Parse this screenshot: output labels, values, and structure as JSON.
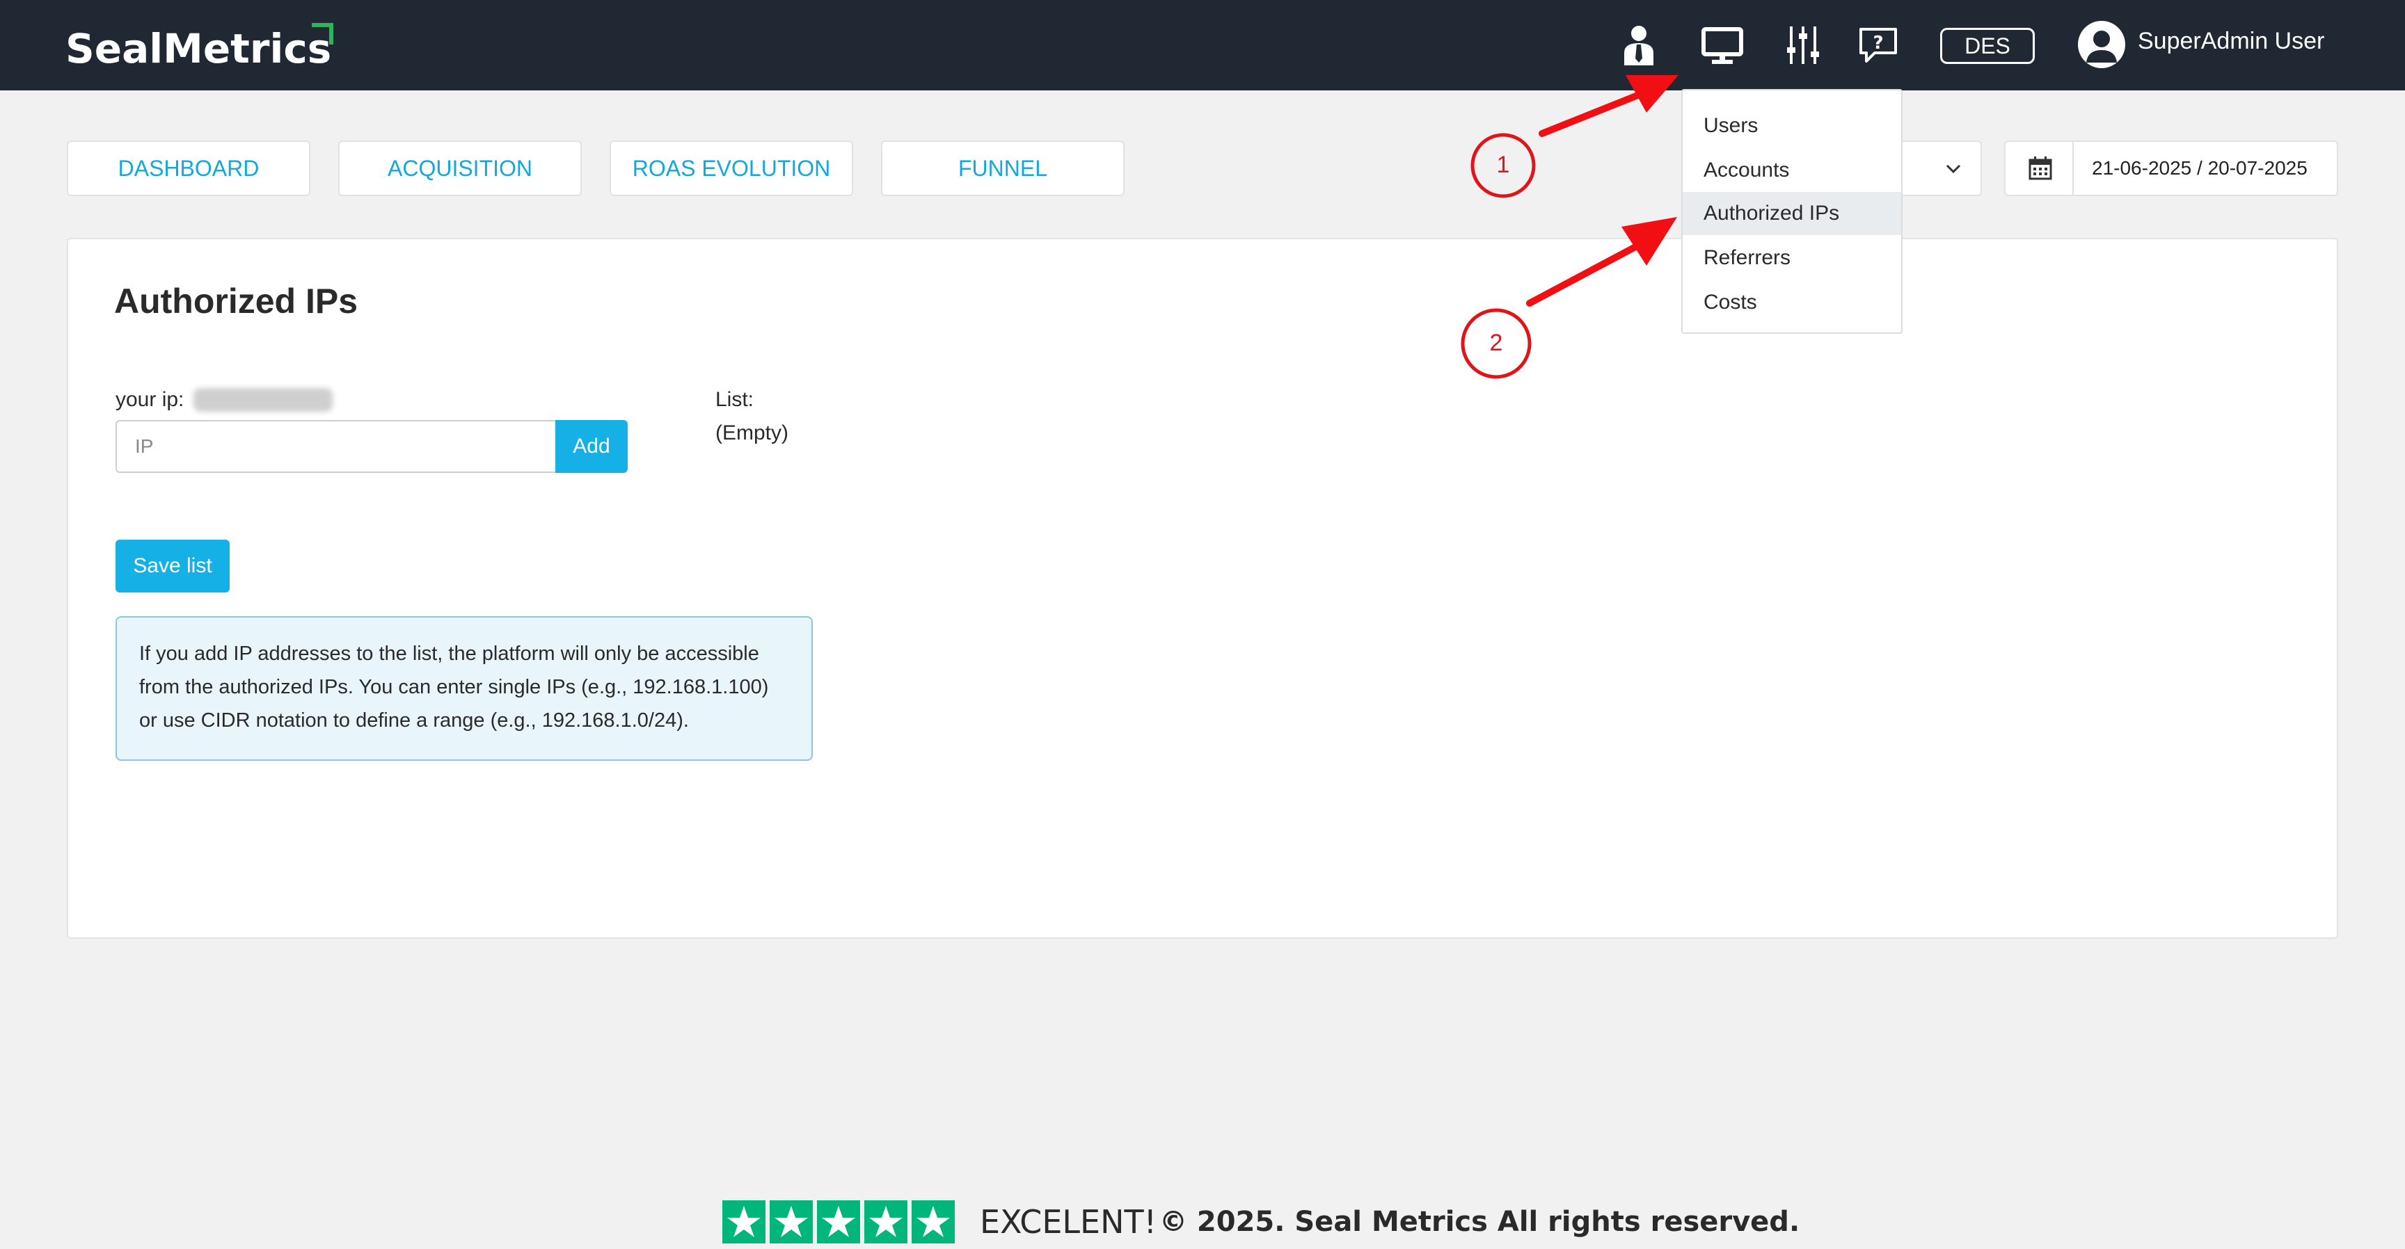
{
  "header": {
    "logo": "SealMetrics",
    "icons": [
      "user-tie-icon",
      "monitor-icon",
      "sliders-icon",
      "help-chat-icon"
    ],
    "env_badge": "DES",
    "user_name": "SuperAdmin User"
  },
  "tabs": [
    {
      "label": "DASHBOARD"
    },
    {
      "label": "ACQUISITION"
    },
    {
      "label": "ROAS EVOLUTION"
    },
    {
      "label": "FUNNEL"
    }
  ],
  "date_range": "21-06-2025 / 20-07-2025",
  "dropdown": {
    "items": [
      {
        "label": "Users"
      },
      {
        "label": "Accounts"
      },
      {
        "label": "Authorized IPs",
        "active": true
      },
      {
        "label": "Referrers"
      },
      {
        "label": "Costs"
      }
    ]
  },
  "page": {
    "title": "Authorized IPs",
    "your_ip_label": "your ip:",
    "ip_input_placeholder": "IP",
    "add_button": "Add",
    "list_label": "List:",
    "list_value": "(Empty)",
    "save_button": "Save list",
    "info_lines": [
      "If you add IP addresses to the list, the platform will only be accessible",
      "from the authorized IPs. You can enter single IPs (e.g., 192.168.1.100)",
      "or use CIDR notation to define a range (e.g., 192.168.1.0/24)."
    ]
  },
  "annotations": {
    "step1": "1",
    "step2": "2",
    "color": "#e0151a"
  },
  "footer": {
    "rating_text": "EXCELENT!",
    "copyright": "© 2025. Seal Metrics All rights reserved."
  }
}
